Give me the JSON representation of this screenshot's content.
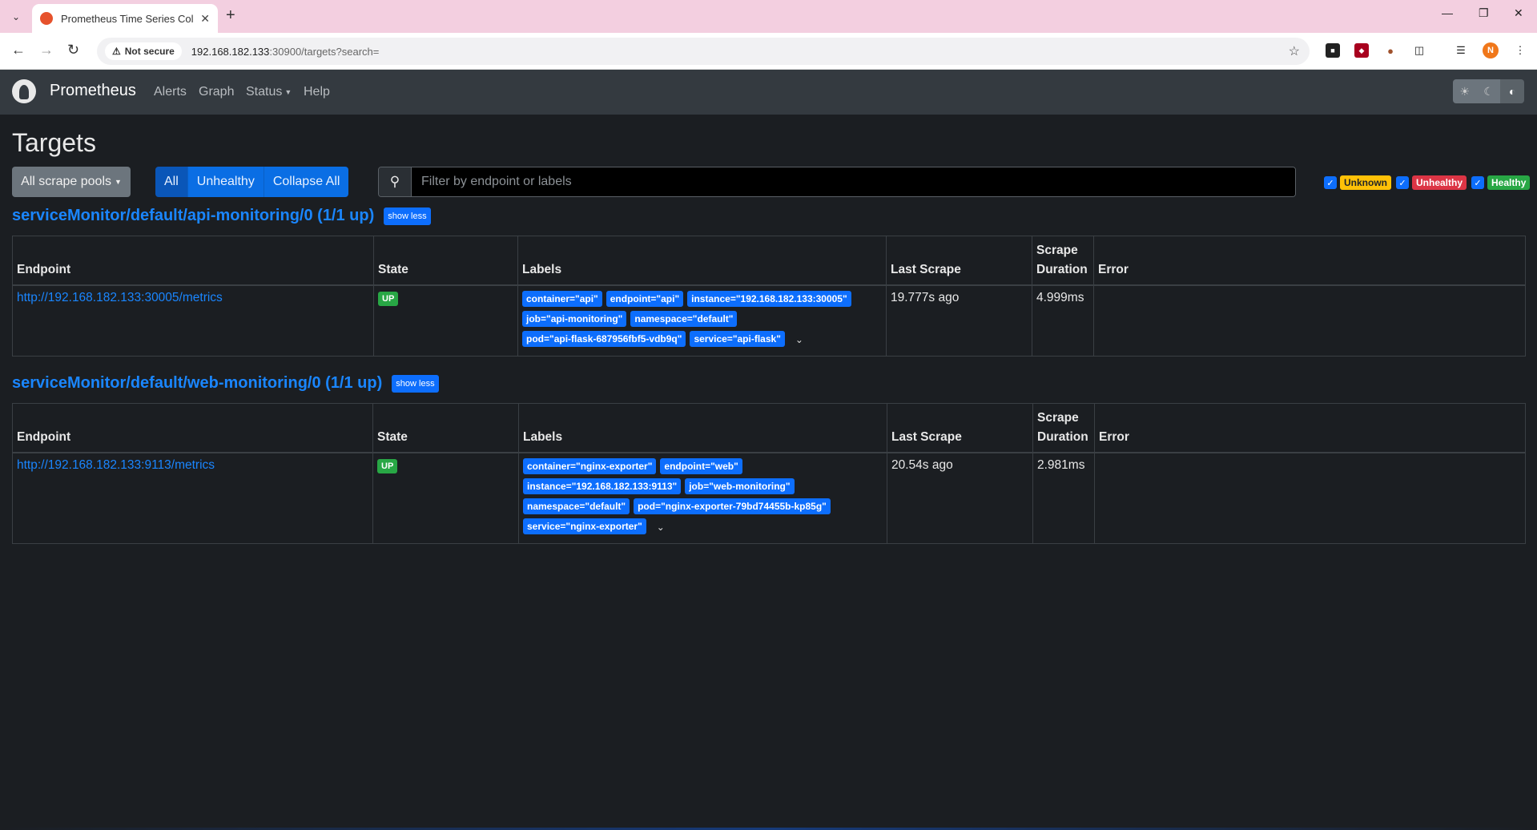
{
  "browser": {
    "tab_title": "Prometheus Time Series Collect",
    "new_tab": "+",
    "not_secure": "Not secure",
    "url_host": "192.168.182.133",
    "url_path": ":30900/targets?search="
  },
  "navbar": {
    "brand": "Prometheus",
    "links": [
      "Alerts",
      "Graph",
      "Status",
      "Help"
    ]
  },
  "page": {
    "title": "Targets",
    "pools_button": "All scrape pools",
    "filters": [
      "All",
      "Unhealthy",
      "Collapse All"
    ],
    "search_placeholder": "Filter by endpoint or labels",
    "health": [
      "Unknown",
      "Unhealthy",
      "Healthy"
    ]
  },
  "columns": [
    "Endpoint",
    "State",
    "Labels",
    "Last Scrape",
    "Scrape Duration",
    "Error"
  ],
  "pools": [
    {
      "title": "serviceMonitor/default/api-monitoring/0 (1/1 up)",
      "toggle": "show less",
      "target": {
        "endpoint": "http://192.168.182.133:30005/metrics",
        "state": "UP",
        "labels": [
          "container=\"api\"",
          "endpoint=\"api\"",
          "instance=\"192.168.182.133:30005\"",
          "job=\"api-monitoring\"",
          "namespace=\"default\"",
          "pod=\"api-flask-687956fbf5-vdb9q\"",
          "service=\"api-flask\""
        ],
        "last_scrape": "19.777s ago",
        "duration": "4.999ms",
        "error": ""
      }
    },
    {
      "title": "serviceMonitor/default/web-monitoring/0 (1/1 up)",
      "toggle": "show less",
      "target": {
        "endpoint": "http://192.168.182.133:9113/metrics",
        "state": "UP",
        "labels": [
          "container=\"nginx-exporter\"",
          "endpoint=\"web\"",
          "instance=\"192.168.182.133:9113\"",
          "job=\"web-monitoring\"",
          "namespace=\"default\"",
          "pod=\"nginx-exporter-79bd74455b-kp85g\"",
          "service=\"nginx-exporter\""
        ],
        "last_scrape": "20.54s ago",
        "duration": "2.981ms",
        "error": ""
      }
    }
  ]
}
